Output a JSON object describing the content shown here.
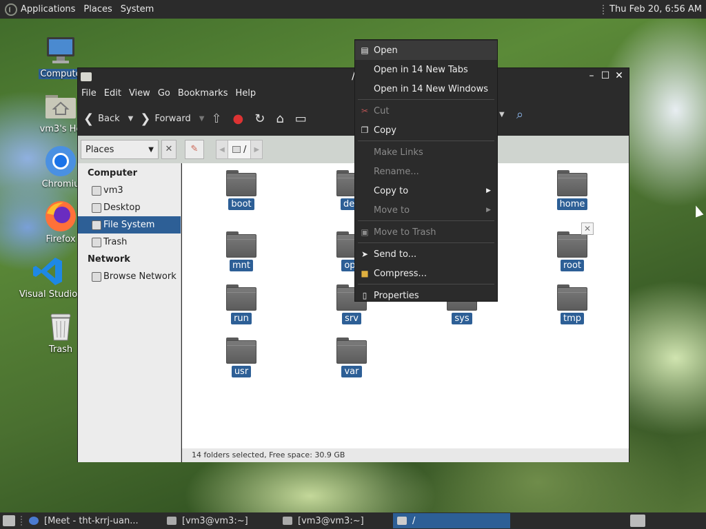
{
  "top_panel": {
    "menus": [
      "Applications",
      "Places",
      "System"
    ],
    "clock": "Thu Feb 20,  6:56 AM"
  },
  "desktop": {
    "icons": [
      {
        "label": "Compute",
        "icon": "computer-icon"
      },
      {
        "label": "vm3's Ho",
        "icon": "home-folder-icon"
      },
      {
        "label": "Chromiu",
        "icon": "chromium-icon"
      },
      {
        "label": "Firefox",
        "icon": "firefox-icon"
      },
      {
        "label": "Visual Studio",
        "icon": "vscode-icon"
      },
      {
        "label": "Trash",
        "icon": "trash-icon"
      }
    ]
  },
  "window": {
    "title": "/",
    "menubar": [
      "File",
      "Edit",
      "View",
      "Go",
      "Bookmarks",
      "Help"
    ],
    "toolbar": {
      "back": "Back",
      "forward": "Forward"
    },
    "location": {
      "places_select": "Places",
      "path_segment": "/"
    },
    "sidebar": {
      "computer_header": "Computer",
      "computer_items": [
        "vm3",
        "Desktop",
        "File System",
        "Trash"
      ],
      "selected": "File System",
      "network_header": "Network",
      "network_items": [
        "Browse Network"
      ]
    },
    "folders": [
      "boot",
      "dev",
      "home",
      "mnt",
      "opt",
      "root",
      "run",
      "srv",
      "sys",
      "tmp",
      "usr",
      "var"
    ],
    "status": "14 folders selected, Free space: 30.9 GB"
  },
  "context_menu": {
    "items": [
      {
        "label": "Open",
        "icon": "folder-open-icon",
        "enabled": true
      },
      {
        "label": "Open in 14 New Tabs",
        "enabled": true
      },
      {
        "label": "Open in 14 New Windows",
        "enabled": true
      },
      {
        "label": "Cut",
        "icon": "scissors-icon",
        "enabled": false
      },
      {
        "label": "Copy",
        "icon": "copy-icon",
        "enabled": true
      },
      {
        "label": "Make Links",
        "enabled": false
      },
      {
        "label": "Rename...",
        "enabled": false
      },
      {
        "label": "Copy to",
        "enabled": true,
        "submenu": true
      },
      {
        "label": "Move to",
        "enabled": false,
        "submenu": true
      },
      {
        "label": "Move to Trash",
        "icon": "trash-icon",
        "enabled": false
      },
      {
        "label": "Send to...",
        "icon": "send-icon",
        "enabled": true
      },
      {
        "label": "Compress...",
        "icon": "archive-icon",
        "enabled": true
      },
      {
        "label": "Properties",
        "icon": "properties-icon",
        "enabled": true
      }
    ]
  },
  "taskbar": {
    "tasks": [
      {
        "label": "[Meet - tht-krrj-uan...",
        "active": false
      },
      {
        "label": "[vm3@vm3:~]",
        "active": false
      },
      {
        "label": "[vm3@vm3:~]",
        "active": false
      },
      {
        "label": "/",
        "active": true
      }
    ]
  },
  "colors": {
    "selection": "#2d5f96",
    "panel": "#2b2b2b"
  }
}
